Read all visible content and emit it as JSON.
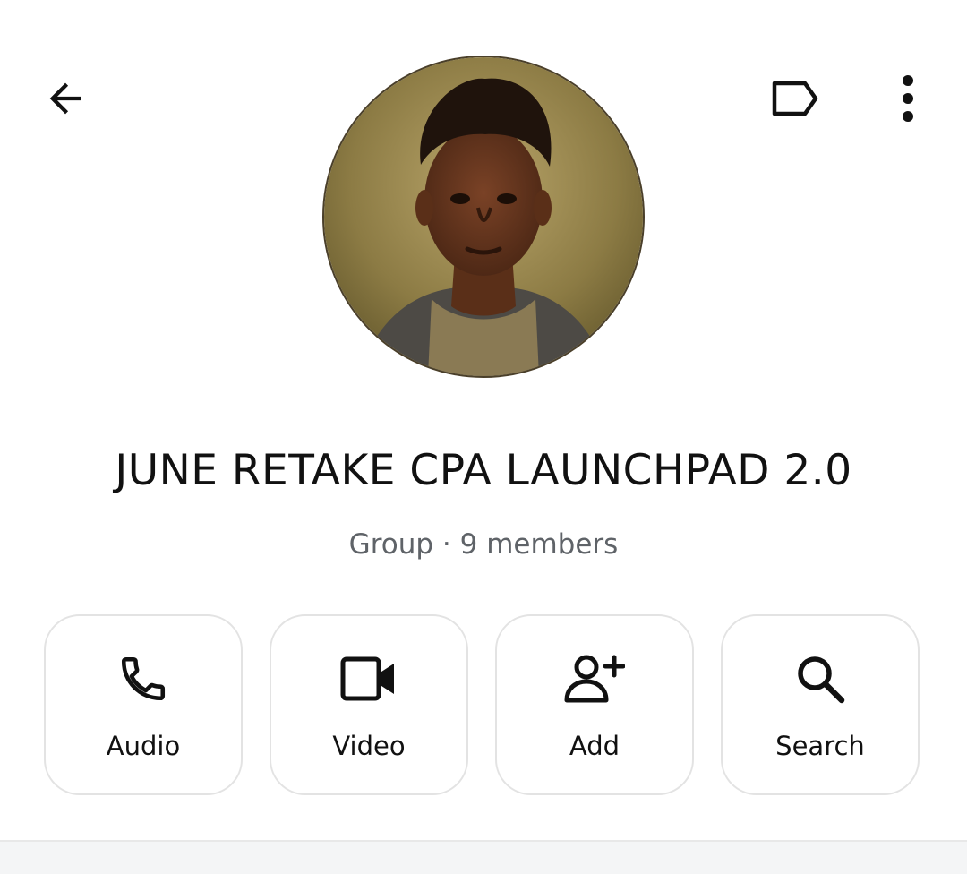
{
  "header": {
    "back_icon": "arrow-left-icon",
    "label_icon": "label-tag-icon",
    "menu_icon": "more-vert-icon"
  },
  "profile": {
    "avatar_description": "group-avatar-portrait",
    "title": "JUNE RETAKE CPA LAUNCHPAD 2.0",
    "subtitle": "Group · 9 members"
  },
  "actions": [
    {
      "label": "Audio",
      "icon": "phone-icon"
    },
    {
      "label": "Video",
      "icon": "video-camera-icon"
    },
    {
      "label": "Add",
      "icon": "add-person-icon"
    },
    {
      "label": "Search",
      "icon": "search-icon"
    }
  ],
  "colors": {
    "text_primary": "#111111",
    "text_secondary": "#5f6368",
    "card_border": "#e3e3e3",
    "background": "#ffffff"
  }
}
